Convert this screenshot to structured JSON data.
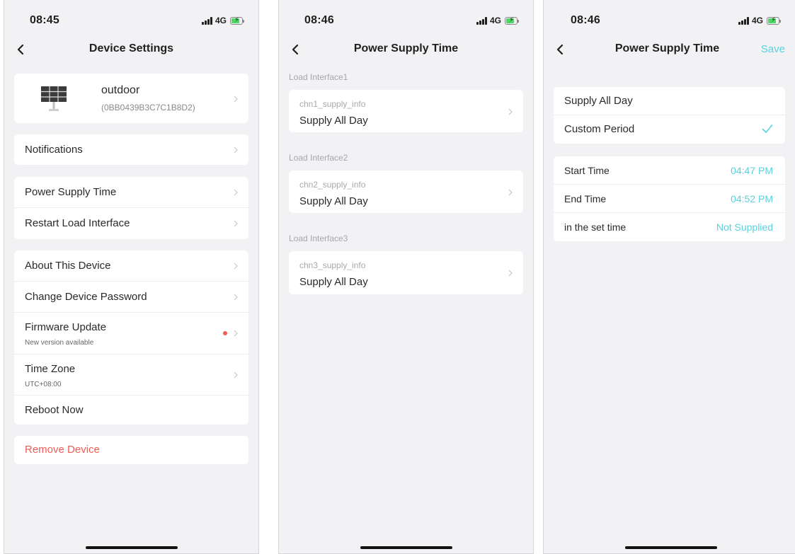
{
  "screen1": {
    "status": {
      "time": "08:45",
      "network": "4G"
    },
    "nav": {
      "title": "Device Settings"
    },
    "device": {
      "name": "outdoor",
      "id": "(0BB0439B3C7C1B8D2)",
      "icon": "solar-panel-icon"
    },
    "items": {
      "notifications": "Notifications",
      "power_supply_time": "Power Supply Time",
      "restart_load_interface": "Restart Load Interface",
      "about_device": "About This Device",
      "change_password": "Change Device Password",
      "firmware_update": "Firmware Update",
      "firmware_update_sub": "New version available",
      "time_zone": "Time Zone",
      "time_zone_sub": "UTC+08:00",
      "reboot_now": "Reboot Now",
      "remove_device": "Remove Device"
    }
  },
  "screen2": {
    "status": {
      "time": "08:46",
      "network": "4G"
    },
    "nav": {
      "title": "Power Supply Time"
    },
    "interfaces": [
      {
        "section": "Load Interface1",
        "key": "chn1_supply_info",
        "value": "Supply All Day"
      },
      {
        "section": "Load Interface2",
        "key": "chn2_supply_info",
        "value": "Supply All Day"
      },
      {
        "section": "Load Interface3",
        "key": "chn3_supply_info",
        "value": "Supply All Day"
      }
    ]
  },
  "screen3": {
    "status": {
      "time": "08:46",
      "network": "4G"
    },
    "nav": {
      "title": "Power Supply Time",
      "save": "Save"
    },
    "modes": {
      "all_day": "Supply All Day",
      "custom": "Custom Period",
      "selected": "Custom Period"
    },
    "settings": {
      "start_label": "Start Time",
      "start_value": "04:47 PM",
      "end_label": "End Time",
      "end_value": "04:52 PM",
      "in_set_label": "in the set time",
      "in_set_value": "Not Supplied"
    }
  },
  "colors": {
    "accent": "#57d3df",
    "danger": "#f25c54",
    "background": "#f2f2f4"
  }
}
